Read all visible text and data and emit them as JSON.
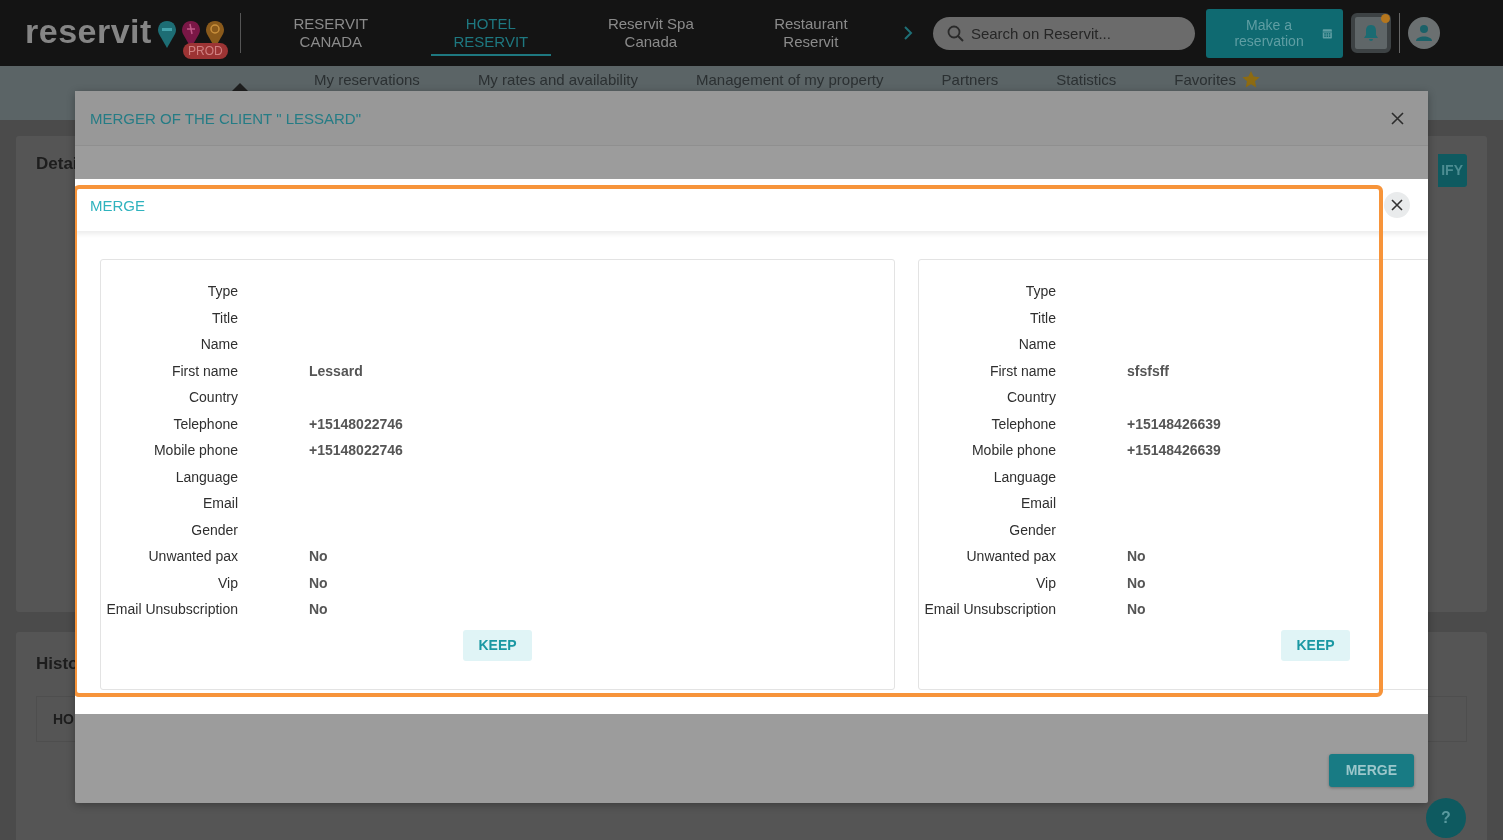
{
  "header": {
    "logo": "reservit",
    "badge": "PROD",
    "tabs": [
      {
        "label": "RESERVIT CANADA",
        "selected": false
      },
      {
        "label": "HOTEL RESERVIT",
        "selected": true
      },
      {
        "label": "Reservit Spa Canada",
        "selected": false
      },
      {
        "label": "Restaurant Reservit",
        "selected": false
      }
    ],
    "search": {
      "placeholder": "Search on Reservit..."
    },
    "reserve_button": "Make a reservation",
    "notifications": {
      "unread": true
    }
  },
  "subnav": [
    {
      "label": "My reservations",
      "starred": false
    },
    {
      "label": "My rates and availability",
      "starred": false
    },
    {
      "label": "Management of my property",
      "starred": false
    },
    {
      "label": "Partners",
      "starred": false
    },
    {
      "label": "Statistics",
      "starred": false
    },
    {
      "label": "Favorites",
      "starred": true
    }
  ],
  "background": {
    "details_title": "Detai",
    "details_button": "IFY",
    "history_title": "Histo",
    "history_column": "HO"
  },
  "merger_dialog": {
    "title": "MERGER OF THE CLIENT \" LESSARD\"",
    "merge_button": "MERGE"
  },
  "merge_dialog": {
    "title": "MERGE",
    "cards": [
      {
        "rows": [
          {
            "label": "Type",
            "value": ""
          },
          {
            "label": "Title",
            "value": ""
          },
          {
            "label": "Name",
            "value": ""
          },
          {
            "label": "First name",
            "value": "Lessard"
          },
          {
            "label": "Country",
            "value": ""
          },
          {
            "label": "Telephone",
            "value": "+15148022746"
          },
          {
            "label": "Mobile phone",
            "value": "+15148022746"
          },
          {
            "label": "Language",
            "value": ""
          },
          {
            "label": "Email",
            "value": ""
          },
          {
            "label": "Gender",
            "value": ""
          },
          {
            "label": "Unwanted pax",
            "value": "No"
          },
          {
            "label": "Vip",
            "value": "No"
          },
          {
            "label": "Email Unsubscription",
            "value": "No"
          }
        ],
        "keep_button": "KEEP"
      },
      {
        "rows": [
          {
            "label": "Type",
            "value": ""
          },
          {
            "label": "Title",
            "value": ""
          },
          {
            "label": "Name",
            "value": ""
          },
          {
            "label": "First name",
            "value": "sfsfsff"
          },
          {
            "label": "Country",
            "value": ""
          },
          {
            "label": "Telephone",
            "value": "+15148426639"
          },
          {
            "label": "Mobile phone",
            "value": "+15148426639"
          },
          {
            "label": "Language",
            "value": ""
          },
          {
            "label": "Email",
            "value": ""
          },
          {
            "label": "Gender",
            "value": ""
          },
          {
            "label": "Unwanted pax",
            "value": "No"
          },
          {
            "label": "Vip",
            "value": "No"
          },
          {
            "label": "Email Unsubscription",
            "value": "No"
          }
        ],
        "keep_button": "KEEP"
      }
    ]
  },
  "help_button": "?"
}
